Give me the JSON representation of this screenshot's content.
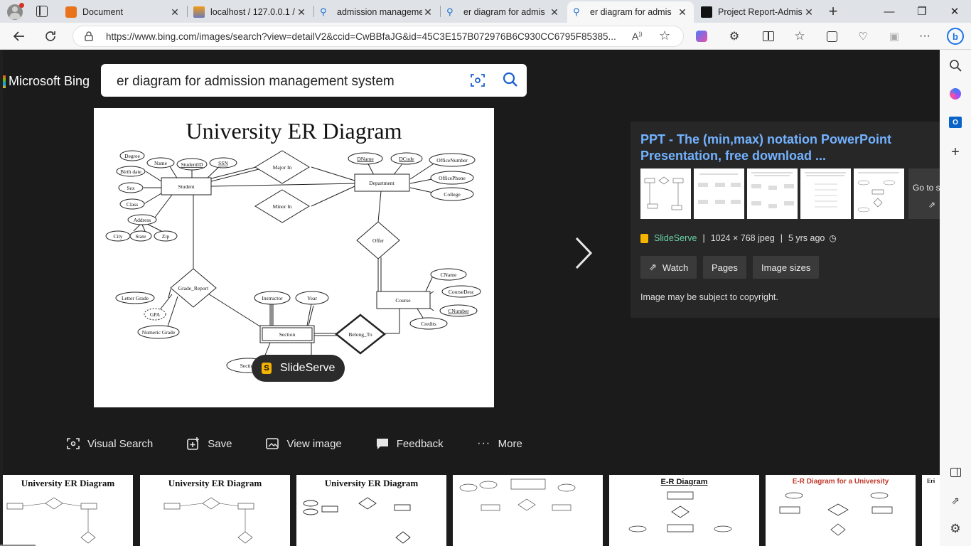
{
  "tabs": [
    {
      "label": "Document",
      "icon": "document-icon"
    },
    {
      "label": "localhost / 127.0.0.1 /",
      "icon": "phpmyadmin-icon"
    },
    {
      "label": "admission management",
      "icon": "search-icon"
    },
    {
      "label": "er diagram for admis",
      "icon": "search-icon"
    },
    {
      "label": "er diagram for admis",
      "icon": "search-icon"
    },
    {
      "label": "Project Report-Admis",
      "icon": "project-icon"
    }
  ],
  "address": {
    "url": "https://www.bing.com/images/search?view=detailV2&ccid=CwBBfaJG&id=45C3E157B072976B6C930CC6795F85385..."
  },
  "bing": {
    "brand": "Microsoft Bing",
    "query": "er diagram for admission management system"
  },
  "diagram": {
    "title": "University ER Diagram",
    "labels": {
      "degree": "Degree",
      "name": "Name",
      "studentid": "StudentID",
      "ssn": "SSN",
      "birth": "Birth date",
      "sex": "Sex",
      "class": "Class",
      "address": "Address",
      "city": "City",
      "state": "State",
      "zip": "Zip",
      "student": "Student",
      "major": "Major In",
      "minor": "Minor In",
      "dname": "DName",
      "dcode": "DCode",
      "office": "OfficeNumber",
      "phone": "OfficePhone",
      "college": "College",
      "department": "Department",
      "offer": "Offer",
      "grade_report": "Grade_Report",
      "letter": "Letter Grade",
      "gpa": "GPA",
      "numeric": "Numeric Grade",
      "instructor": "Instructor",
      "year": "Year",
      "section": "Section",
      "belong": "Belong_To",
      "course": "Course",
      "cname": "CName",
      "cdesc": "CourseDesc",
      "cnumber": "CNumber",
      "credits": "Credits",
      "section_attr": "Section"
    }
  },
  "source_pill": "SlideServe",
  "info": {
    "title": "PPT - The (min,max) notation PowerPoint Presentation, free download ...",
    "goto_label": "Go to s",
    "source": "SlideServe",
    "dims": "1024 × 768 jpeg",
    "age": "5 yrs ago",
    "buttons": [
      "Watch",
      "Pages",
      "Image sizes"
    ],
    "copyright": "Image may be subject to copyright."
  },
  "actions": [
    {
      "label": "Visual Search",
      "icon": "visual-search-icon"
    },
    {
      "label": "Save",
      "icon": "save-icon"
    },
    {
      "label": "View image",
      "icon": "view-image-icon"
    },
    {
      "label": "Feedback",
      "icon": "feedback-icon"
    },
    {
      "label": "More",
      "icon": "more-icon"
    }
  ],
  "strip": [
    {
      "title": "University ER Diagram"
    },
    {
      "title": "University ER Diagram"
    },
    {
      "title": "University ER Diagram"
    },
    {
      "title": ""
    },
    {
      "title": "E-R Diagram"
    },
    {
      "title": "E-R Diagram for a University"
    },
    {
      "title": "Eri"
    }
  ],
  "colors": {
    "page_bg": "#1b1b1b",
    "link_blue": "#73b2ff",
    "source_green": "#69d0a6",
    "tab_bg": "#dfe3e8"
  }
}
